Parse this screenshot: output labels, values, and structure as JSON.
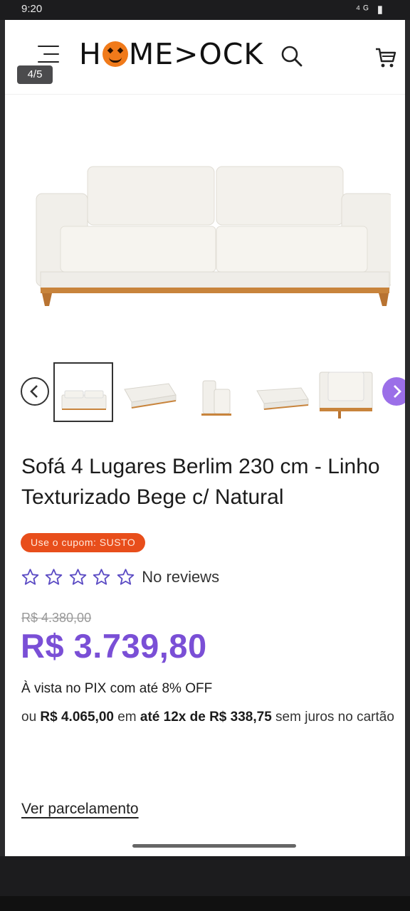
{
  "statusbar": {
    "time": "9:20",
    "icons": "⁴ᴳ ▮"
  },
  "header": {
    "logo_pre": "H",
    "logo_post": "ME>OCK",
    "page_indicator": "4/5"
  },
  "product": {
    "title": "Sofá 4 Lugares Berlim 230 cm - Linho Texturizado Bege c/ Natural",
    "coupon": "Use o cupom: SUSTO",
    "reviews_label": "No reviews",
    "rating": 0,
    "rating_max": 5,
    "old_price": "R$ 4.380,00",
    "price": "R$ 3.739,80",
    "pix_text": "À vista no PIX com até 8% OFF",
    "inst_prefix": "ou ",
    "inst_total": "R$ 4.065,00",
    "inst_mid": " em ",
    "inst_plan": "até 12x de R$ 338,75",
    "inst_suffix": " sem juros no cartão",
    "details_link": "Ver parcelamento"
  },
  "colors": {
    "accent": "#7a4fd6",
    "coupon_bg": "#e84e1b",
    "arrow_next": "#9b6fe8"
  }
}
